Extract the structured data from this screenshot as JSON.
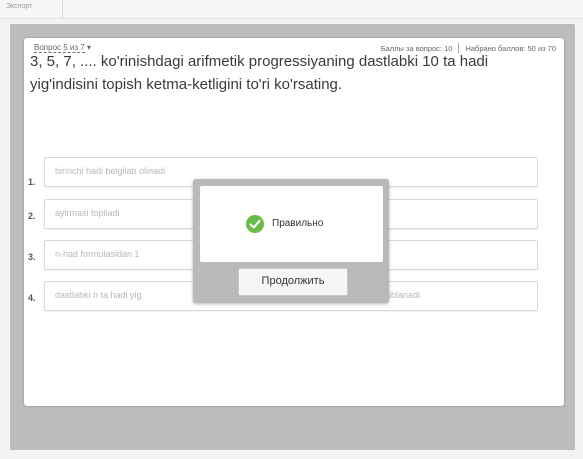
{
  "window": {
    "tab_label": "Экспорт"
  },
  "header": {
    "question_counter": "Вопрос 5 из 7",
    "points_for_question": "Баллы за вопрос: 10",
    "points_total": "Набрано баллов: 50 из 70"
  },
  "question": {
    "text": "3, 5, 7, .... ko'rinishdagi arifmetik progressiyaning dastlabki 10 ta hadi yig'indisini topish ketma-ketligini to'ri ko'rsating."
  },
  "options": [
    {
      "number": "1.",
      "text": "birinchi hadi belgilab olinadi"
    },
    {
      "number": "2.",
      "text": "ayirmasi topiladi"
    },
    {
      "number": "3.",
      "text": "n-had formulasidan 1"
    },
    {
      "number": "4.",
      "text": "dastlabki n ta hadi yig",
      "tail": "l hisoblanadi"
    }
  ],
  "feedback_dialog": {
    "message": "Правильно",
    "continue_label": "Продолжить",
    "icon": "check-circle-icon",
    "icon_color": "#66bb46"
  }
}
